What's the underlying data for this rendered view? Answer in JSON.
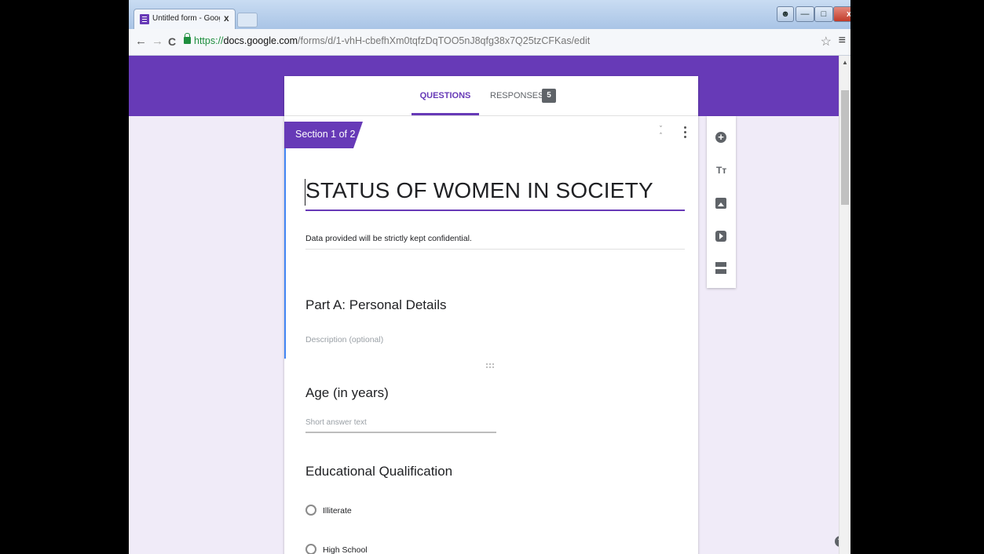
{
  "browser": {
    "tab_title": "Untitled form - Google Fo",
    "tab_close": "x",
    "url_scheme": "https://",
    "url_host": "docs.google.com",
    "url_path": "/forms/d/1-vhH-cbefhXm0tqfzDqTOO5nJ8qfg38x7Q25tzCFKas/edit",
    "back": "←",
    "forward": "→",
    "reload": "C",
    "star": "☆",
    "menu": "≡",
    "win_close": "x"
  },
  "form": {
    "tabs": {
      "questions": "QUESTIONS",
      "responses": "RESPONSES",
      "responses_count": "5"
    },
    "section_label": "Section 1 of 2",
    "title": "STATUS OF WOMEN IN SOCIETY",
    "description": "Data provided will be strictly kept confidential.",
    "part_title": "Part A: Personal Details",
    "part_description_placeholder": "Description (optional)",
    "questions": [
      {
        "title": "Age (in years)",
        "answer_placeholder": "Short answer text"
      },
      {
        "title": "Educational Qualification",
        "options": [
          "Illiterate",
          "High School"
        ]
      }
    ]
  },
  "side_toolbar": {
    "icons": [
      "add-question-icon",
      "title-icon",
      "image-icon",
      "video-icon",
      "section-icon"
    ],
    "title_glyph": "Tт"
  },
  "help": "?",
  "colors": {
    "accent": "#673ab7",
    "background": "#f0ebf8",
    "focus_bar": "#4285f4"
  }
}
